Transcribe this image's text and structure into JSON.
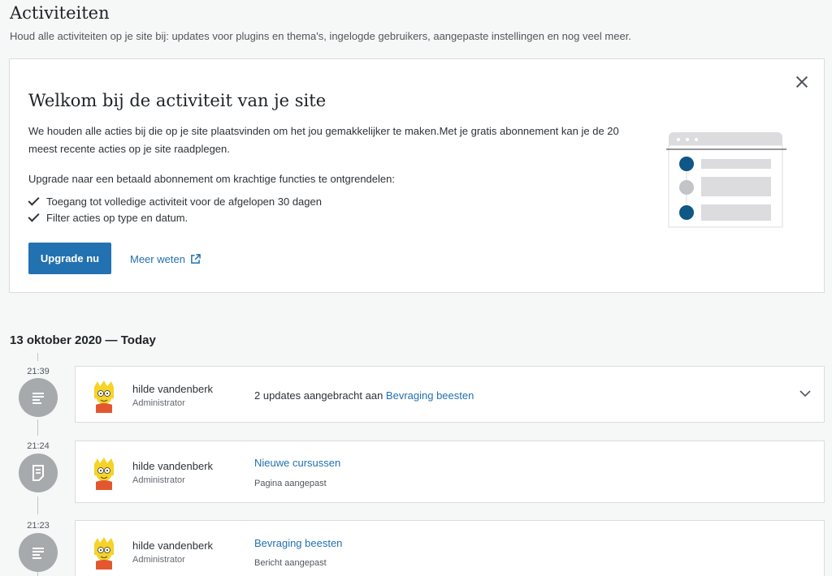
{
  "header": {
    "title": "Activiteiten",
    "subtitle": "Houd alle activiteiten op je site bij: updates voor plugins en thema's, ingelogde gebruikers, aangepaste instellingen en nog veel meer."
  },
  "banner": {
    "title": "Welkom bij de activiteit van je site",
    "description": "We houden alle acties bij die op je site plaatsvinden om het jou gemakkelijker te maken.Met je gratis abonnement kan je de 20 meest recente acties op je site raadplegen.",
    "upgrade_text": "Upgrade naar een betaald abonnement om krachtige functies te ontgrendelen:",
    "features": [
      "Toegang tot volledige activiteit voor de afgelopen 30 dagen",
      "Filter acties op type en datum."
    ],
    "upgrade_button": "Upgrade nu",
    "learn_more": "Meer weten",
    "close_icon": "close-icon",
    "accent_color": "#2271b1",
    "illustration_dot_color": "#0e5787"
  },
  "day": {
    "heading": "13 oktober 2020 — Today"
  },
  "events": [
    {
      "time": "21:39",
      "icon": "posts-list-icon",
      "actor_name": "hilde vandenberk",
      "actor_role": "Administrator",
      "summary_prefix": "2 updates aangebracht aan ",
      "summary_link": "Bevraging beesten",
      "expandable": "chevron-down-icon"
    },
    {
      "time": "21:24",
      "icon": "page-icon",
      "actor_name": "hilde vandenberk",
      "actor_role": "Administrator",
      "link": "Nieuwe cursussen",
      "sub": "Pagina aangepast"
    },
    {
      "time": "21:23",
      "icon": "posts-list-icon",
      "actor_name": "hilde vandenberk",
      "actor_role": "Administrator",
      "link": "Bevraging beesten",
      "sub": "Bericht aangepast"
    }
  ]
}
